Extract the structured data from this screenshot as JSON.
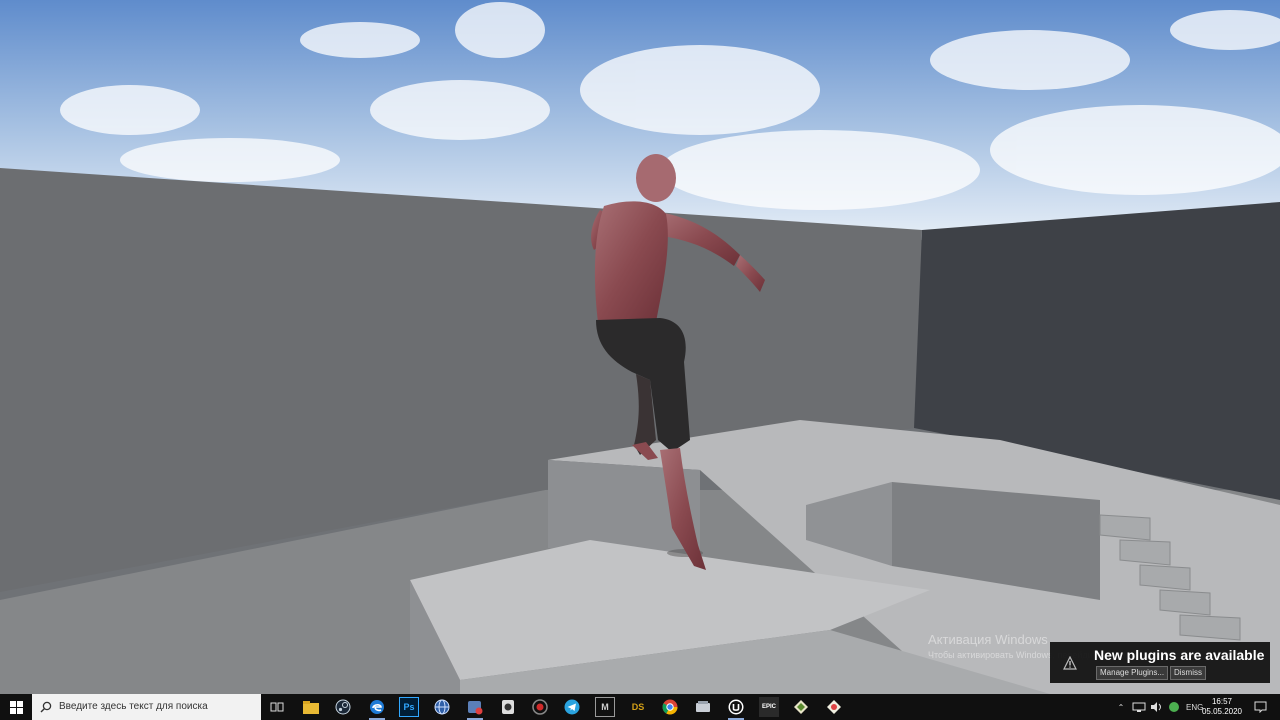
{
  "windows_watermark": {
    "title": "Активация Windows",
    "subtitle": "Чтобы активировать Windows, перейдите в раздел «Параметры»."
  },
  "plugin_notification": {
    "title": "New plugins are available",
    "manage_label": "Manage Plugins...",
    "dismiss_label": "Dismiss",
    "icon": "warning-icon"
  },
  "taskbar": {
    "search_placeholder": "Введите здесь текст для поиска",
    "apps": [
      {
        "name": "task-view",
        "icon": "task-view-icon"
      },
      {
        "name": "file-explorer",
        "icon": "folder-icon"
      },
      {
        "name": "steam",
        "icon": "steam-icon"
      },
      {
        "name": "edge",
        "icon": "edge-icon"
      },
      {
        "name": "photoshop",
        "icon": "photoshop-icon",
        "label": "Ps"
      },
      {
        "name": "app-blue",
        "icon": "globe-app-icon"
      },
      {
        "name": "app-badge",
        "icon": "badge-app-icon"
      },
      {
        "name": "app-camera",
        "icon": "camera-app-icon"
      },
      {
        "name": "app-record",
        "icon": "record-app-icon"
      },
      {
        "name": "telegram",
        "icon": "telegram-icon"
      },
      {
        "name": "app-m",
        "icon": "m-app-icon",
        "label": "M"
      },
      {
        "name": "daz-studio",
        "icon": "daz-icon",
        "label": "DS"
      },
      {
        "name": "chrome",
        "icon": "chrome-icon"
      },
      {
        "name": "app-drive",
        "icon": "drive-app-icon"
      },
      {
        "name": "unreal-engine",
        "icon": "unreal-icon"
      },
      {
        "name": "epic-games",
        "icon": "epic-icon",
        "label": "EPIC"
      },
      {
        "name": "app-green",
        "icon": "green-app-icon"
      },
      {
        "name": "app-tool",
        "icon": "tool-app-icon"
      }
    ],
    "tray": {
      "language": "ENG",
      "time": "16:57",
      "date": "05.05.2020"
    }
  }
}
